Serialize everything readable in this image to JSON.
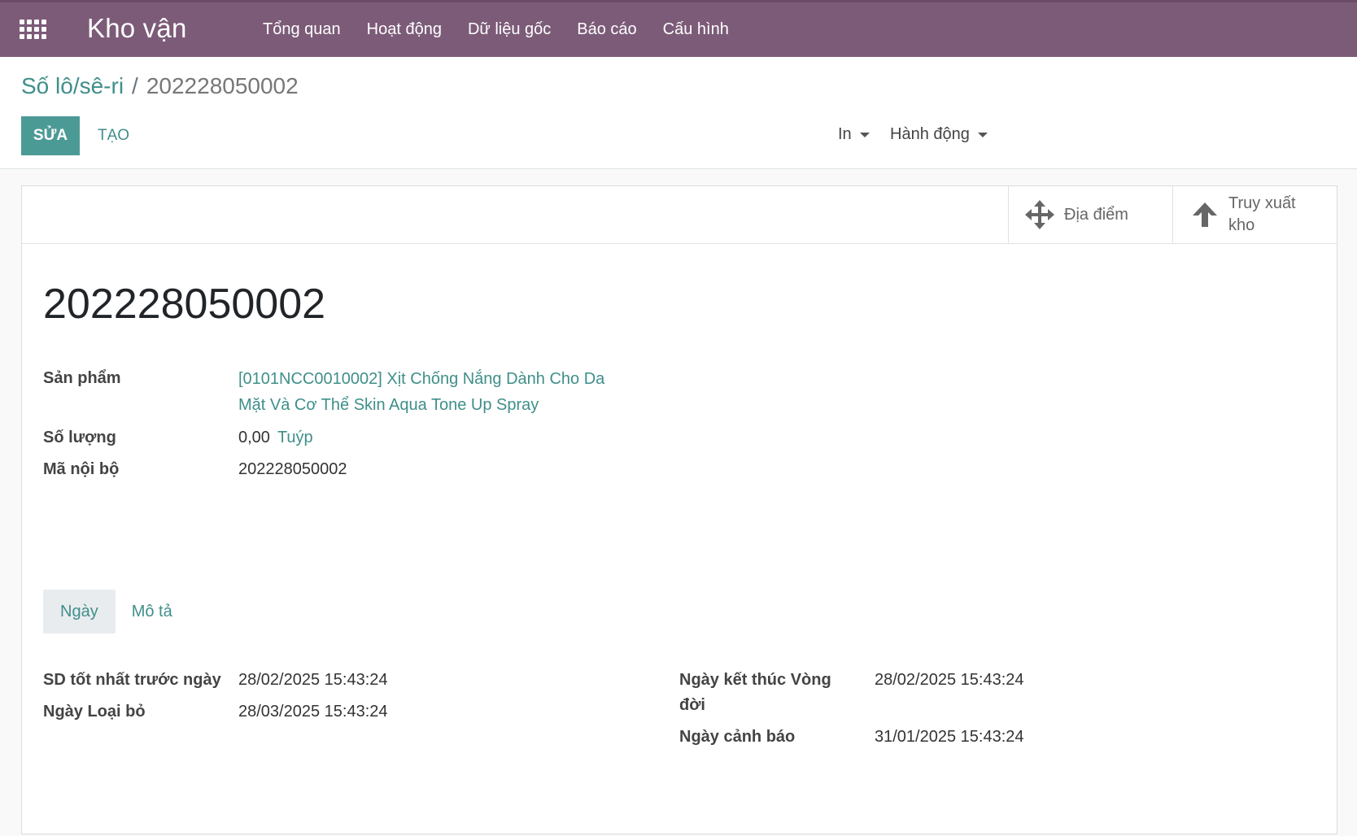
{
  "navbar": {
    "brand": "Kho vận",
    "menu": [
      "Tổng quan",
      "Hoạt động",
      "Dữ liệu gốc",
      "Báo cáo",
      "Cấu hình"
    ]
  },
  "breadcrumb": {
    "parent": "Số lô/sê-ri",
    "separator": "/",
    "current": "202228050002"
  },
  "actions": {
    "edit_label": "SỬA",
    "create_label": "TẠO",
    "print_label": "In",
    "action_label": "Hành động"
  },
  "smart_buttons": {
    "location_label": "Địa điểm",
    "traceability_label": "Truy xuất kho"
  },
  "record": {
    "name": "202228050002",
    "fields": {
      "product_label": "Sản phẩm",
      "product_value": "[0101NCC0010002] Xịt Chống Nắng Dành Cho Da Mặt Và Cơ Thể Skin Aqua Tone Up Spray",
      "quantity_label": "Số lượng",
      "quantity_value": "0,00",
      "quantity_uom": "Tuýp",
      "ref_label": "Mã nội bộ",
      "ref_value": "202228050002"
    }
  },
  "tabs": [
    "Ngày",
    "Mô tả"
  ],
  "dates": {
    "use_date_label": "SD tốt nhất trước ngày",
    "use_date_value": "28/02/2025 15:43:24",
    "removal_date_label": "Ngày Loại bỏ",
    "removal_date_value": "28/03/2025 15:43:24",
    "expiration_date_label": "Ngày kết thúc Vòng đời",
    "expiration_date_value": "28/02/2025 15:43:24",
    "alert_date_label": "Ngày cảnh báo",
    "alert_date_value": "31/01/2025 15:43:24"
  },
  "colors": {
    "navbar": "#7c5b78",
    "primary": "#4c9a96",
    "link": "#3f8f8a"
  }
}
